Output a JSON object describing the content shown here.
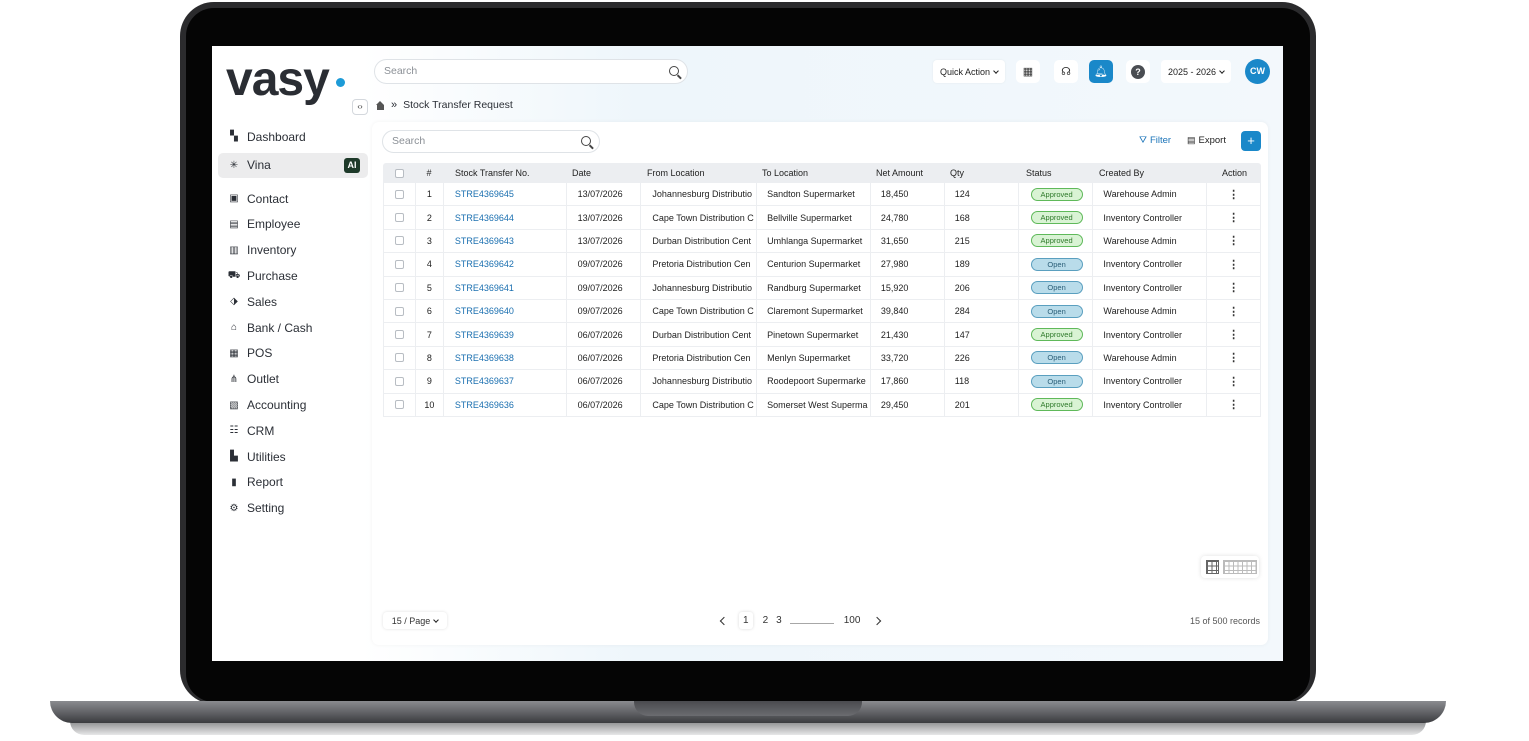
{
  "brand": {
    "logo_text": "vasy",
    "accent": "#1d9bd7"
  },
  "sidebar": {
    "items": [
      {
        "label": "Dashboard",
        "icon": "dashboard-icon"
      },
      {
        "label": "Vina",
        "icon": "sparkle-icon",
        "badge": "AI"
      },
      {
        "label": "Contact",
        "icon": "contact-icon"
      },
      {
        "label": "Employee",
        "icon": "employee-icon"
      },
      {
        "label": "Inventory",
        "icon": "inventory-icon"
      },
      {
        "label": "Purchase",
        "icon": "cart-icon"
      },
      {
        "label": "Sales",
        "icon": "sales-icon"
      },
      {
        "label": "Bank / Cash",
        "icon": "bank-icon"
      },
      {
        "label": "POS",
        "icon": "pos-icon"
      },
      {
        "label": "Outlet",
        "icon": "outlet-icon"
      },
      {
        "label": "Accounting",
        "icon": "accounting-icon"
      },
      {
        "label": "CRM",
        "icon": "crm-icon"
      },
      {
        "label": "Utilities",
        "icon": "utilities-icon"
      },
      {
        "label": "Report",
        "icon": "report-icon"
      },
      {
        "label": "Setting",
        "icon": "gear-icon"
      }
    ]
  },
  "topbar": {
    "search_placeholder": "Search",
    "quick_action": "Quick Action",
    "year": "2025 - 2026",
    "avatar": "CW"
  },
  "breadcrumb": {
    "page": "Stock Transfer Request"
  },
  "toolbar": {
    "search_placeholder": "Search",
    "filter_label": "Filter",
    "export_label": "Export",
    "add_label": "+"
  },
  "table": {
    "headers": [
      "#",
      "Stock Transfer No.",
      "Date",
      "From Location",
      "To Location",
      "Net Amount",
      "Qty",
      "Status",
      "Created By",
      "Action"
    ],
    "rows": [
      {
        "n": "1",
        "no": "STRE4369645",
        "date": "13/07/2026",
        "from": "Johannesburg Distributio",
        "to": "Sandton Supermarket",
        "amount": "18,450",
        "qty": "124",
        "status": "Approved",
        "by": "Warehouse Admin"
      },
      {
        "n": "2",
        "no": "STRE4369644",
        "date": "13/07/2026",
        "from": "Cape Town Distribution C",
        "to": "Bellville Supermarket",
        "amount": "24,780",
        "qty": "168",
        "status": "Approved",
        "by": "Inventory Controller"
      },
      {
        "n": "3",
        "no": "STRE4369643",
        "date": "13/07/2026",
        "from": "Durban Distribution Cent",
        "to": "Umhlanga Supermarket",
        "amount": "31,650",
        "qty": "215",
        "status": "Approved",
        "by": "Warehouse Admin"
      },
      {
        "n": "4",
        "no": "STRE4369642",
        "date": "09/07/2026",
        "from": "Pretoria Distribution Cen",
        "to": "Centurion Supermarket",
        "amount": "27,980",
        "qty": "189",
        "status": "Open",
        "by": "Inventory Controller"
      },
      {
        "n": "5",
        "no": "STRE4369641",
        "date": "09/07/2026",
        "from": "Johannesburg Distributio",
        "to": "Randburg Supermarket",
        "amount": "15,920",
        "qty": "206",
        "status": "Open",
        "by": "Inventory Controller"
      },
      {
        "n": "6",
        "no": "STRE4369640",
        "date": "09/07/2026",
        "from": "Cape Town Distribution C",
        "to": "Claremont Supermarket",
        "amount": "39,840",
        "qty": "284",
        "status": "Open",
        "by": "Warehouse Admin"
      },
      {
        "n": "7",
        "no": "STRE4369639",
        "date": "06/07/2026",
        "from": "Durban Distribution Cent",
        "to": "Pinetown Supermarket",
        "amount": "21,430",
        "qty": "147",
        "status": "Approved",
        "by": "Inventory Controller"
      },
      {
        "n": "8",
        "no": "STRE4369638",
        "date": "06/07/2026",
        "from": "Pretoria Distribution Cen",
        "to": "Menlyn Supermarket",
        "amount": "33,720",
        "qty": "226",
        "status": "Open",
        "by": "Warehouse Admin"
      },
      {
        "n": "9",
        "no": "STRE4369637",
        "date": "06/07/2026",
        "from": "Johannesburg Distributio",
        "to": "Roodepoort Supermarke",
        "amount": "17,860",
        "qty": "118",
        "status": "Open",
        "by": "Inventory Controller"
      },
      {
        "n": "10",
        "no": "STRE4369636",
        "date": "06/07/2026",
        "from": "Cape Town Distribution C",
        "to": "Somerset West Superma",
        "amount": "29,450",
        "qty": "201",
        "status": "Approved",
        "by": "Inventory Controller"
      }
    ]
  },
  "pagination": {
    "per_page": "15 / Page",
    "pages": [
      "1",
      "2",
      "3"
    ],
    "ellipsis": "......................",
    "last_page": "100",
    "records": "15 of 500 records"
  }
}
